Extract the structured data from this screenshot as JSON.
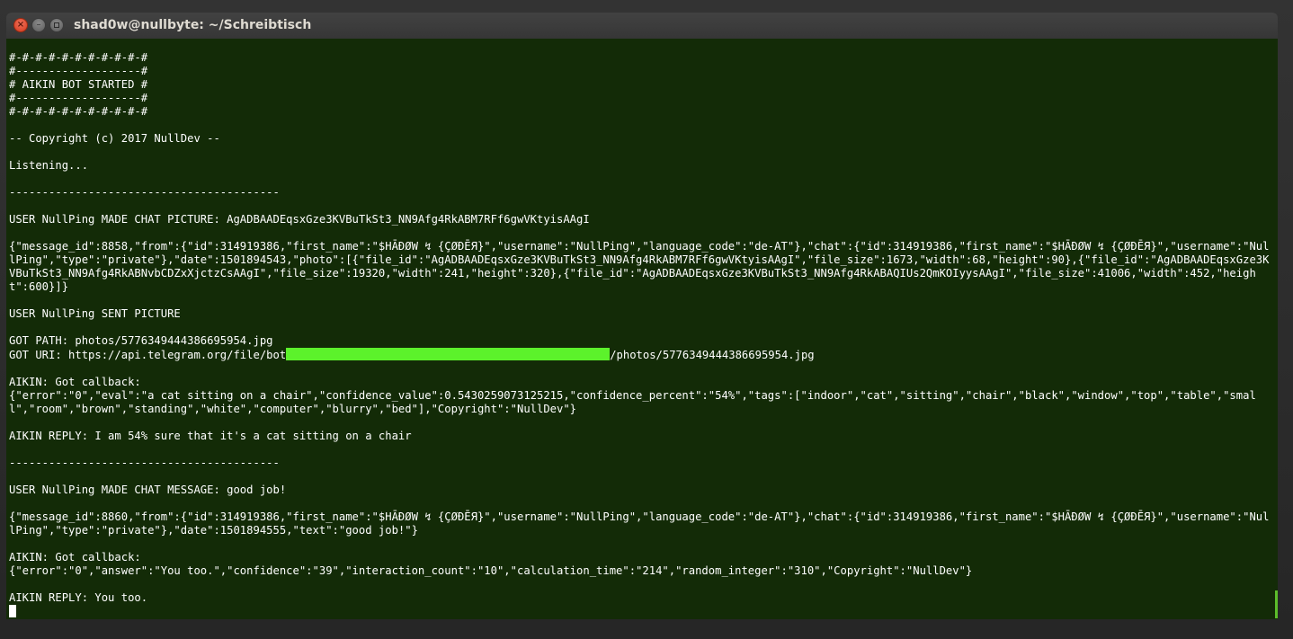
{
  "window": {
    "title": "shad0w@nullbyte: ~/Schreibtisch",
    "controls": {
      "close_glyph": "×",
      "minimize_glyph": "–",
      "maximize_icon": "maximize-icon"
    }
  },
  "terminal": {
    "background": "#132b07",
    "foreground": "#ffffff",
    "highlight_color": "#5cf22b",
    "lines": {
      "l01": "#-#-#-#-#-#-#-#-#-#-#",
      "l02": "#-------------------#",
      "l03": "# AIKIN BOT STARTED #",
      "l04": "#-------------------#",
      "l05": "#-#-#-#-#-#-#-#-#-#-#",
      "l06": "",
      "l07": "-- Copyright (c) 2017 NullDev --",
      "l08": "",
      "l09": "Listening...",
      "l10": "",
      "l11": "-----------------------------------------",
      "l12": "",
      "l13": "USER NullPing MADE CHAT PICTURE: AgADBAADEqsxGze3KVBuTkSt3_NN9Afg4RkABM7RFf6gwVKtyisAAgI",
      "l14": "",
      "l15": "{\"message_id\":8858,\"from\":{\"id\":314919386,\"first_name\":\"$HĀĐØW ↯ {ÇØĐĒЯ}\",\"username\":\"NullPing\",\"language_code\":\"de-AT\"},\"chat\":{\"id\":314919386,\"first_name\":\"$HĀĐØW ↯ {ÇØĐĒЯ}\",\"username\":\"NullPing\",\"type\":\"private\"},\"date\":1501894543,\"photo\":[{\"file_id\":\"AgADBAADEqsxGze3KVBuTkSt3_NN9Afg4RkABM7RFf6gwVKtyisAAgI\",\"file_size\":1673,\"width\":68,\"height\":90},{\"file_id\":\"AgADBAADEqsxGze3KVBuTkSt3_NN9Afg4RkABNvbCDZxXjctzCsAAgI\",\"file_size\":19320,\"width\":241,\"height\":320},{\"file_id\":\"AgADBAADEqsxGze3KVBuTkSt3_NN9Afg4RkABAQIUs2QmKOIyysAAgI\",\"file_size\":41006,\"width\":452,\"height\":600}]}",
      "l16": "",
      "l17": "USER NullPing SENT PICTURE",
      "l18": "",
      "l19": "GOT PATH: photos/5776349444386695954.jpg",
      "l20_prefix": "GOT URI: https://api.telegram.org/file/bot",
      "l20_suffix": "/photos/5776349444386695954.jpg",
      "l21": "",
      "l22": "AIKIN: Got callback:",
      "l23": "{\"error\":\"0\",\"eval\":\"a cat sitting on a chair\",\"confidence_value\":0.5430259073125215,\"confidence_percent\":\"54%\",\"tags\":[\"indoor\",\"cat\",\"sitting\",\"chair\",\"black\",\"window\",\"top\",\"table\",\"small\",\"room\",\"brown\",\"standing\",\"white\",\"computer\",\"blurry\",\"bed\"],\"Copyright\":\"NullDev\"}",
      "l24": "",
      "l25": "AIKIN REPLY: I am 54% sure that it's a cat sitting on a chair",
      "l26": "",
      "l27": "-----------------------------------------",
      "l28": "",
      "l29": "USER NullPing MADE CHAT MESSAGE: good job!",
      "l30": "",
      "l31": "{\"message_id\":8860,\"from\":{\"id\":314919386,\"first_name\":\"$HĀĐØW ↯ {ÇØĐĒЯ}\",\"username\":\"NullPing\",\"language_code\":\"de-AT\"},\"chat\":{\"id\":314919386,\"first_name\":\"$HĀĐØW ↯ {ÇØĐĒЯ}\",\"username\":\"NullPing\",\"type\":\"private\"},\"date\":1501894555,\"text\":\"good job!\"}",
      "l32": "",
      "l33": "AIKIN: Got callback:",
      "l34": "{\"error\":\"0\",\"answer\":\"You too.\",\"confidence\":\"39\",\"interaction_count\":\"10\",\"calculation_time\":\"214\",\"random_integer\":\"310\",\"Copyright\":\"NullDev\"}",
      "l35": "",
      "l36": "AIKIN REPLY: You too."
    }
  }
}
